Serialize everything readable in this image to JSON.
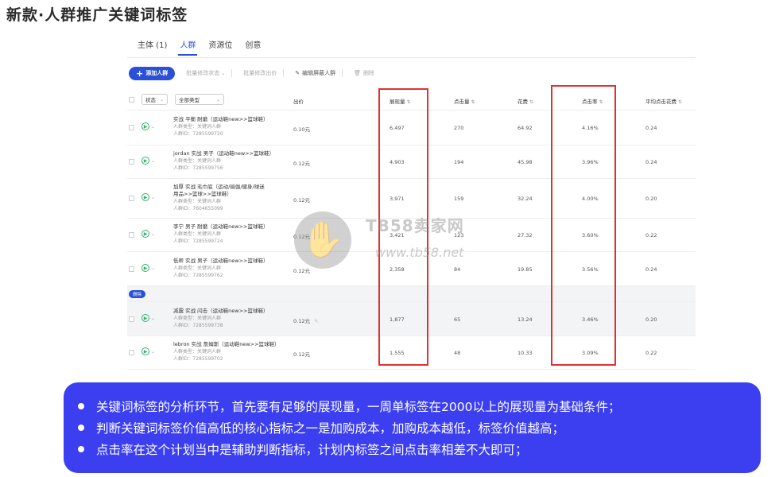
{
  "page_title": "新款·人群推广关键词标签",
  "tabs": [
    {
      "label": "主体 (1)",
      "active": false
    },
    {
      "label": "人群",
      "active": true
    },
    {
      "label": "资源位",
      "active": false
    },
    {
      "label": "创意",
      "active": false
    }
  ],
  "toolbar": {
    "add_label": "添加人群",
    "bulk_status": "批量修改状态",
    "bulk_bid": "批量修改出价",
    "edit_block": "编辑屏蔽人群",
    "delete": "删除"
  },
  "table": {
    "filter_status": "状态",
    "filter_type": "全部类型",
    "columns": {
      "bid": "出价",
      "impressions": "展现量",
      "clicks": "点击量",
      "cost": "花费",
      "ctr": "点击率",
      "avg_cpc": "平均点击花费"
    },
    "rows": [
      {
        "name": "实战 平衡 耐磨（运动鞋new>>篮球鞋）",
        "type": "人群类型：关键词人群",
        "id": "人群ID：7285599720",
        "bid": "0.10元",
        "impressions": "6,497",
        "clicks": "270",
        "cost": "64.92",
        "ctr": "4.16%",
        "avg_cpc": "0.24"
      },
      {
        "name": "jordan 实战 男子（运动鞋new>>篮球鞋）",
        "type": "人群类型：关键词人群",
        "id": "人群ID：7285599756",
        "bid": "0.12元",
        "impressions": "4,903",
        "clicks": "194",
        "cost": "45.98",
        "ctr": "3.96%",
        "avg_cpc": "0.24"
      },
      {
        "name": "加厚 实战 毛巾底（运动/瑜伽/健身/球迷用品>>篮球>>篮球鞋）",
        "type": "人群类型：关键词人群",
        "id": "人群ID：7604655099",
        "bid": "0.12元",
        "impressions": "3,971",
        "clicks": "159",
        "cost": "32.24",
        "ctr": "4.00%",
        "avg_cpc": "0.20"
      },
      {
        "name": "李宁 男子 耐磨（运动鞋new>>篮球鞋）",
        "type": "人群类型：关键词人群",
        "id": "人群ID：7285599724",
        "bid": "0.12元",
        "impressions": "3,421",
        "clicks": "123",
        "cost": "27.32",
        "ctr": "3.60%",
        "avg_cpc": "0.22"
      },
      {
        "name": "低帮 实战 男子（运动鞋new>>篮球鞋）",
        "type": "人群类型：关键词人群",
        "id": "人群ID：7285599762",
        "bid": "0.12元",
        "impressions": "2,358",
        "clicks": "84",
        "cost": "19.85",
        "ctr": "3.56%",
        "avg_cpc": "0.24"
      },
      {
        "name": "减震 实战 闪击（运动鞋new>>篮球鞋）",
        "type": "人群类型：关键词人群",
        "id": "人群ID：7285599738",
        "bid": "0.12元",
        "impressions": "1,877",
        "clicks": "65",
        "cost": "13.24",
        "ctr": "3.46%",
        "avg_cpc": "0.20"
      },
      {
        "name": "lebron 实战 詹姆斯（运动鞋new>>篮球鞋）",
        "type": "人群类型：关键词人群",
        "id": "人群ID：7285599702",
        "bid": "0.12元",
        "impressions": "1,555",
        "clicks": "48",
        "cost": "10.33",
        "ctr": "3.09%",
        "avg_cpc": "0.22"
      }
    ],
    "badge": "删除"
  },
  "watermark": {
    "title": "TB58卖家网",
    "url": "www.tb58.net"
  },
  "notes": [
    "关键词标签的分析环节，首先要有足够的展现量，一周单标签在2000以上的展现量为基础条件；",
    "判断关键词标签价值高低的核心指标之一是加购成本，加购成本越低，标签价值越高；",
    "点击率在这个计划当中是辅助判断指标，计划内标签之间点击率相差不大即可；"
  ],
  "colors": {
    "accent": "#2a4fd9",
    "highlight": "#e03131",
    "note_bg": "#3b3ff0"
  }
}
